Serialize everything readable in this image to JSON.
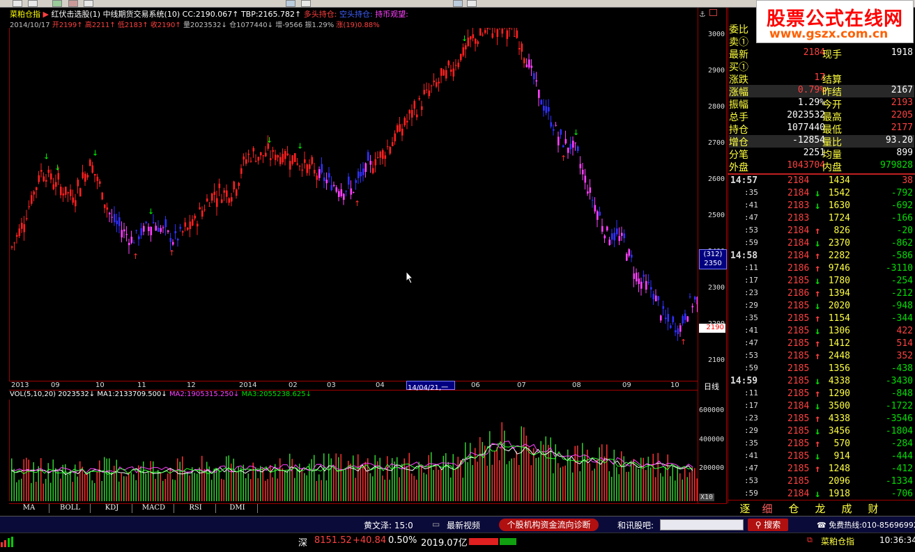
{
  "header": {
    "instrument": "菜粕仓指",
    "indicator": "红伏击选股(1)",
    "system": "中线期货交易系统(10)",
    "cc": "CC:2190.067",
    "tbp": "TBP:2165.782",
    "long_hold": "多头持仓:",
    "short_hold": "空头持仓:",
    "watch": "持币观望:",
    "date": "2014/10/17",
    "open": "开2199",
    "high": "高2211",
    "low": "低2183",
    "close": "收2190",
    "volume": "量2023532",
    "position": "仓1077440",
    "change_pos": "增-9566",
    "amplitude": "振1.29%",
    "rise": "涨(19)0.88%"
  },
  "price_axis": [
    "3000",
    "2900",
    "2800",
    "2700",
    "2600",
    "2500",
    "2400",
    "2300",
    "2200",
    "2100"
  ],
  "price_markers": {
    "cursor_box_top": "(312)",
    "cursor_box_bottom": "2350",
    "last_price": "2190"
  },
  "x_axis": [
    "2013",
    "09",
    "10",
    "11",
    "12",
    "2014",
    "02",
    "03",
    "04",
    "14/04/21,一",
    "06",
    "07",
    "08",
    "09",
    "10"
  ],
  "period_label": "日线",
  "volume_header": {
    "title": "VOL(5,10,20) 2023532",
    "ma1": "MA1:2133709.500",
    "ma2": "MA2:1905315.250",
    "ma3": "MA3:2055238.625"
  },
  "volume_axis": [
    "600000",
    "400000",
    "200000",
    "X10"
  ],
  "bottom_tabs": [
    "MA",
    "BOLL",
    "KDJ",
    "MACD",
    "RSI",
    "DMI"
  ],
  "logo": {
    "line1": "股票公式在线网",
    "line2": "www.gszx.com.cn"
  },
  "quote_panel": {
    "rows": [
      {
        "l1": "委比",
        "v1": "",
        "l2": "",
        "v2": ""
      },
      {
        "l1": "卖①",
        "v1": "",
        "l2": "",
        "v2": ""
      },
      {
        "l1": "最新",
        "v1": "2184",
        "l2": "现手",
        "v2": "1918"
      },
      {
        "l1": "买①",
        "v1": "",
        "l2": "",
        "v2": ""
      },
      {
        "l1": "涨跌",
        "v1": "17",
        "l2": "结算",
        "v2": ""
      },
      {
        "l1": "涨幅",
        "v1": "0.79%",
        "l2": "昨结",
        "v2": "2167"
      },
      {
        "l1": "振幅",
        "v1": "1.29%",
        "l2": "今开",
        "v2": "2193"
      },
      {
        "l1": "总手",
        "v1": "2023532",
        "l2": "最高",
        "v2": "2205"
      },
      {
        "l1": "持仓",
        "v1": "1077440",
        "l2": "最低",
        "v2": "2177"
      },
      {
        "l1": "增仓",
        "v1": "-12854",
        "l2": "量比",
        "v2": "93.20"
      },
      {
        "l1": "分笔",
        "v1": "2251",
        "l2": "均量",
        "v2": "899"
      },
      {
        "l1": "外盘",
        "v1": "1043704",
        "l2": "内盘",
        "v2": "979828"
      }
    ],
    "colors": {
      "up": "#ff4040",
      "down": "#00e000",
      "neutral": "#ffffff"
    }
  },
  "ticks": [
    {
      "t": "14:57",
      "p": "2184",
      "a": "",
      "v": "1434",
      "d": "38"
    },
    {
      "t": ":35",
      "p": "2184",
      "a": "down",
      "v": "1542",
      "d": "-792"
    },
    {
      "t": ":41",
      "p": "2183",
      "a": "down",
      "v": "1630",
      "d": "-692"
    },
    {
      "t": ":47",
      "p": "2183",
      "a": "",
      "v": "1724",
      "d": "-166"
    },
    {
      "t": ":53",
      "p": "2184",
      "a": "up",
      "v": "826",
      "d": "-20"
    },
    {
      "t": ":59",
      "p": "2184",
      "a": "down",
      "v": "2370",
      "d": "-862"
    },
    {
      "t": "14:58",
      "p": "2184",
      "a": "up",
      "v": "2282",
      "d": "-586"
    },
    {
      "t": ":11",
      "p": "2186",
      "a": "up",
      "v": "9746",
      "d": "-3110"
    },
    {
      "t": ":17",
      "p": "2185",
      "a": "down",
      "v": "1780",
      "d": "-254"
    },
    {
      "t": ":23",
      "p": "2186",
      "a": "up",
      "v": "1394",
      "d": "-212"
    },
    {
      "t": ":29",
      "p": "2185",
      "a": "down",
      "v": "2020",
      "d": "-948"
    },
    {
      "t": ":35",
      "p": "2185",
      "a": "up",
      "v": "1154",
      "d": "-344"
    },
    {
      "t": ":41",
      "p": "2185",
      "a": "down",
      "v": "1306",
      "d": "422"
    },
    {
      "t": ":47",
      "p": "2185",
      "a": "up",
      "v": "1412",
      "d": "514"
    },
    {
      "t": ":53",
      "p": "2185",
      "a": "up",
      "v": "2448",
      "d": "352"
    },
    {
      "t": ":59",
      "p": "2185",
      "a": "",
      "v": "1356",
      "d": "-438"
    },
    {
      "t": "14:59",
      "p": "2185",
      "a": "down",
      "v": "4338",
      "d": "-3430"
    },
    {
      "t": ":11",
      "p": "2185",
      "a": "up",
      "v": "1290",
      "d": "-848"
    },
    {
      "t": ":17",
      "p": "2184",
      "a": "down",
      "v": "3500",
      "d": "-1722"
    },
    {
      "t": ":23",
      "p": "2185",
      "a": "up",
      "v": "4338",
      "d": "-3546"
    },
    {
      "t": ":29",
      "p": "2185",
      "a": "down",
      "v": "3456",
      "d": "-1804"
    },
    {
      "t": ":35",
      "p": "2185",
      "a": "up",
      "v": "570",
      "d": "-284"
    },
    {
      "t": ":41",
      "p": "2185",
      "a": "down",
      "v": "914",
      "d": "-444"
    },
    {
      "t": ":47",
      "p": "2185",
      "a": "up",
      "v": "1248",
      "d": "-412"
    },
    {
      "t": ":53",
      "p": "2185",
      "a": "",
      "v": "2096",
      "d": "-1334"
    },
    {
      "t": ":59",
      "p": "2184",
      "a": "down",
      "v": "1918",
      "d": "-706"
    }
  ],
  "right_tabs": [
    "逐",
    "细",
    "仓",
    "龙",
    "成",
    "财"
  ],
  "statusbar": {
    "user": "黄文泽: 15:0",
    "video": "最新视频",
    "diag": "个股机构资金流向诊断",
    "forum": "和讯股吧:",
    "search": "搜索",
    "hotline": "免费热线:010-85696992"
  },
  "taskbar": {
    "index_name": "深",
    "index_value": "8151.52",
    "index_change": "+40.84",
    "index_pct": "0.50%",
    "turnover": "2019.07亿",
    "window": "菜粕仓指",
    "clock": "10:36:34"
  }
}
